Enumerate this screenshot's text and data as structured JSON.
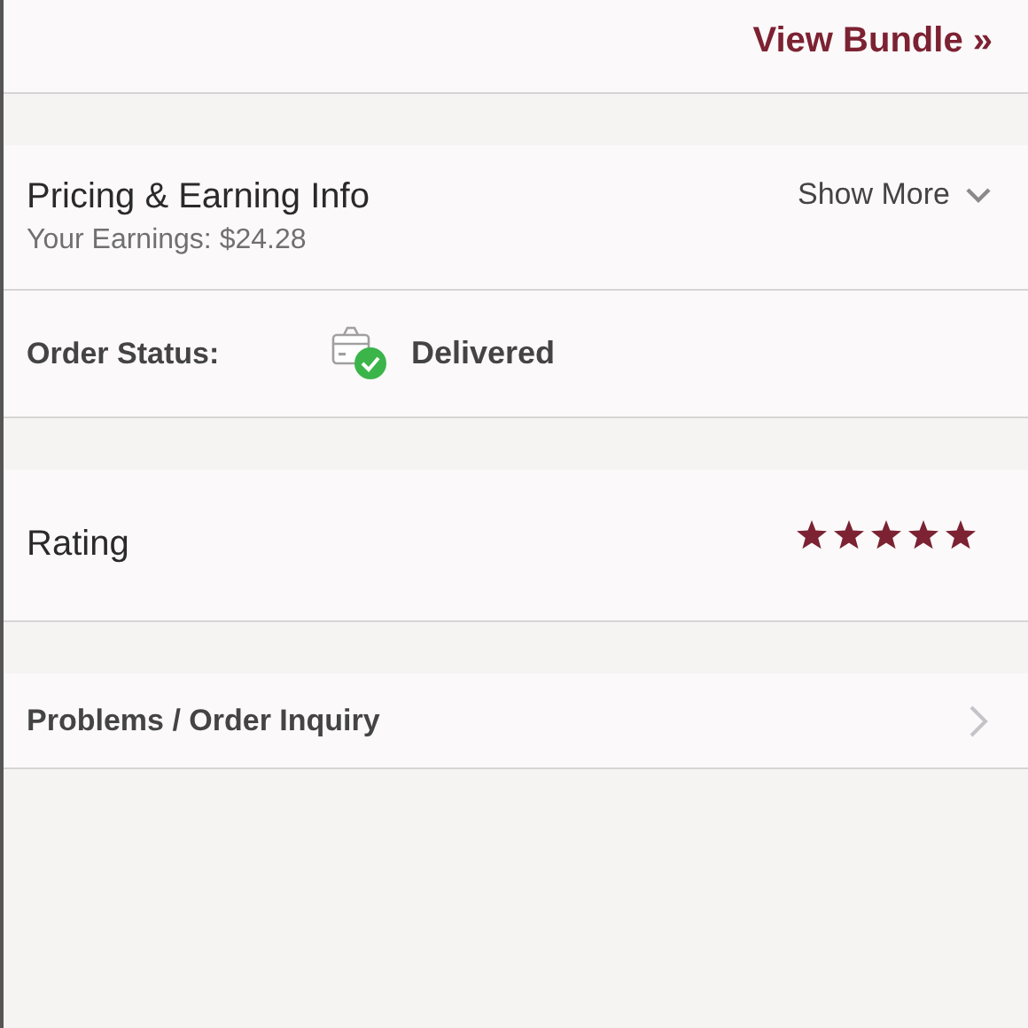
{
  "bundle_link": "View Bundle »",
  "pricing": {
    "title": "Pricing & Earning Info",
    "earnings": "Your Earnings: $24.28",
    "toggle": "Show More",
    "expanded": false
  },
  "order_status": {
    "label": "Order Status:",
    "value": "Delivered"
  },
  "rating": {
    "label": "Rating",
    "stars": 5
  },
  "problems": {
    "label": "Problems / Order Inquiry"
  }
}
